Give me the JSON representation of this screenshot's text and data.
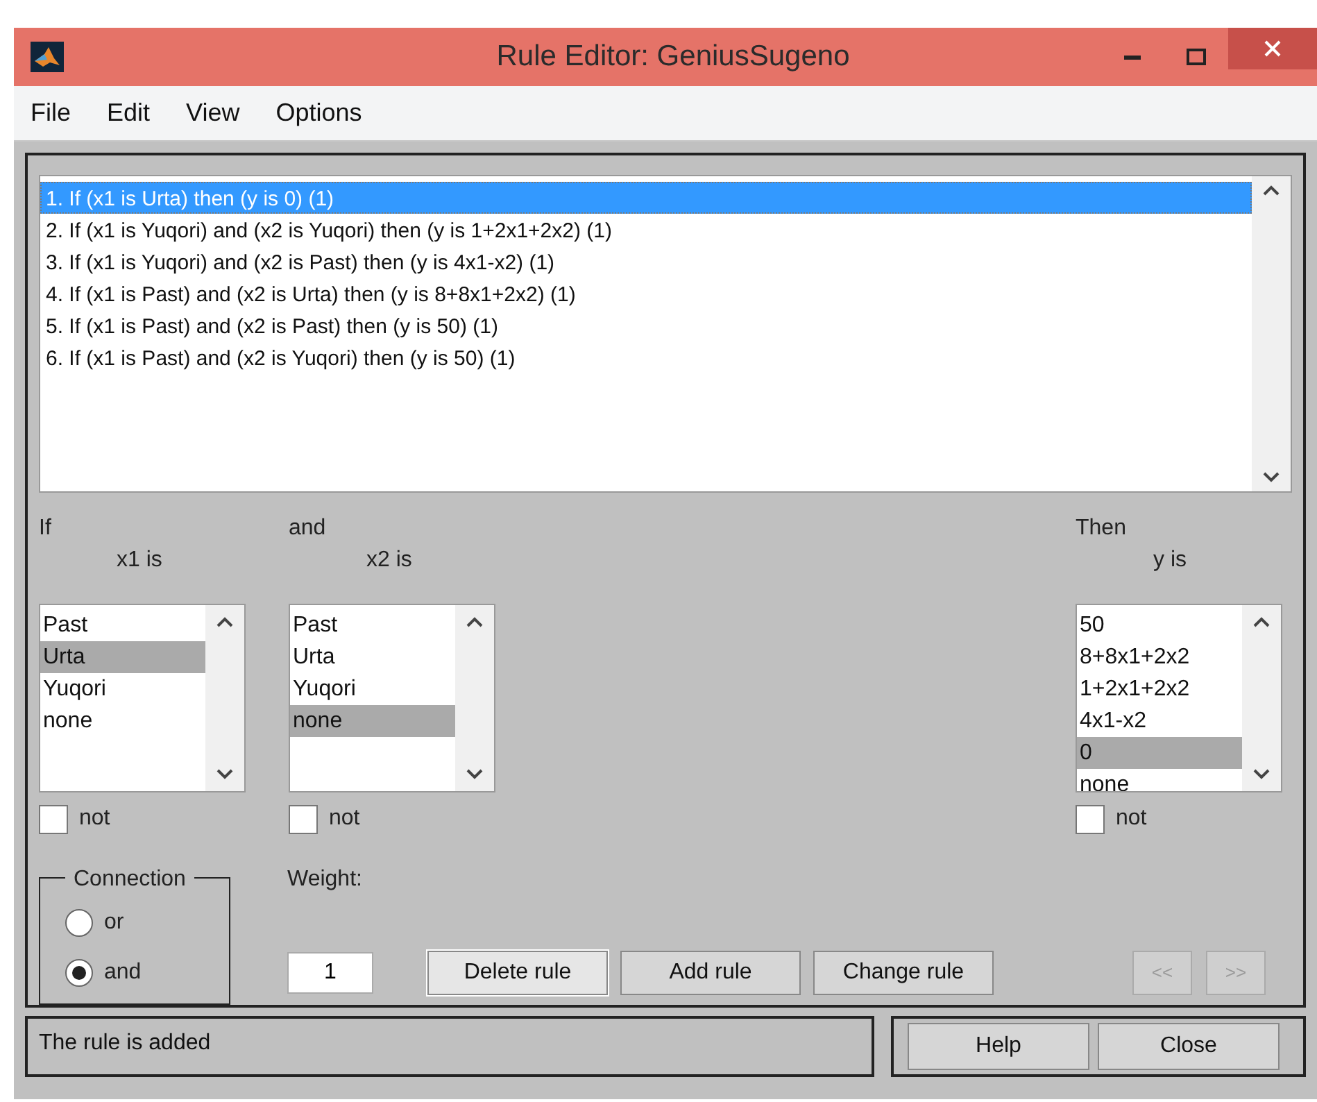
{
  "window": {
    "title": "Rule Editor: GeniusSugeno"
  },
  "menu": [
    "File",
    "Edit",
    "View",
    "Options"
  ],
  "rules": [
    {
      "text": "1. If (x1 is Urta) then (y is 0) (1)",
      "selected": true
    },
    {
      "text": "2. If (x1 is Yuqori) and (x2 is Yuqori) then (y is 1+2x1+2x2) (1)",
      "selected": false
    },
    {
      "text": "3. If (x1 is Yuqori) and (x2 is Past) then (y is 4x1-x2) (1)",
      "selected": false
    },
    {
      "text": "4. If (x1 is Past) and (x2 is Urta) then (y is 8+8x1+2x2) (1)",
      "selected": false
    },
    {
      "text": "5. If (x1 is Past) and (x2 is Past) then (y is 50) (1)",
      "selected": false
    },
    {
      "text": "6. If (x1 is Past) and (x2 is Yuqori) then (y is 50) (1)",
      "selected": false
    }
  ],
  "antecedents": [
    {
      "heading": "If",
      "variable": "x1 is",
      "items": [
        {
          "label": "Past",
          "selected": false
        },
        {
          "label": "Urta",
          "selected": true
        },
        {
          "label": "Yuqori",
          "selected": false
        },
        {
          "label": "none",
          "selected": false
        }
      ],
      "not": {
        "label": "not",
        "checked": false
      }
    },
    {
      "heading": "and",
      "variable": "x2 is",
      "items": [
        {
          "label": "Past",
          "selected": false
        },
        {
          "label": "Urta",
          "selected": false
        },
        {
          "label": "Yuqori",
          "selected": false
        },
        {
          "label": "none",
          "selected": true
        }
      ],
      "not": {
        "label": "not",
        "checked": false
      }
    }
  ],
  "consequent": {
    "heading": "Then",
    "variable": "y is",
    "items": [
      {
        "label": "50",
        "selected": false
      },
      {
        "label": "8+8x1+2x2",
        "selected": false
      },
      {
        "label": "1+2x1+2x2",
        "selected": false
      },
      {
        "label": "4x1-x2",
        "selected": false
      },
      {
        "label": "0",
        "selected": true
      },
      {
        "label": "none",
        "selected": false
      }
    ],
    "not": {
      "label": "not",
      "checked": false
    }
  },
  "connection": {
    "title": "Connection",
    "options": [
      {
        "label": "or",
        "selected": false
      },
      {
        "label": "and",
        "selected": true
      }
    ]
  },
  "weight": {
    "label": "Weight:",
    "value": "1"
  },
  "rule_buttons": [
    {
      "label": "Delete rule",
      "focused": true
    },
    {
      "label": "Add rule",
      "focused": false
    },
    {
      "label": "Change rule",
      "focused": false
    }
  ],
  "nav_buttons": [
    {
      "label": "<<",
      "disabled": true
    },
    {
      "label": ">>",
      "disabled": true
    }
  ],
  "status": "The rule is added",
  "footer_buttons": [
    "Help",
    "Close"
  ]
}
